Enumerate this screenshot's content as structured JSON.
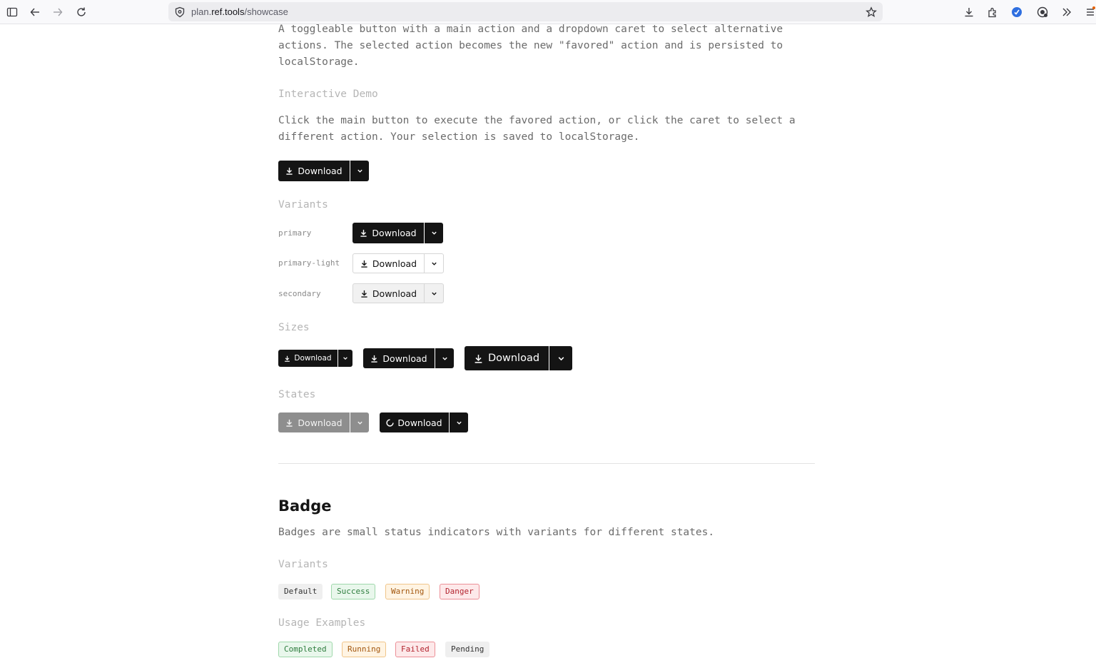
{
  "browser": {
    "url_prefix": "plan.",
    "url_domain": "ref.tools",
    "url_path": "/showcase"
  },
  "intro": {
    "description": "A toggleable button with a main action and a dropdown caret to select alternative actions. The selected action becomes the new \"favored\" action and is persisted to localStorage."
  },
  "demo": {
    "heading": "Interactive Demo",
    "description": "Click the main button to execute the favored action, or click the caret to select a different action. Your selection is saved to localStorage.",
    "button_label": "Download"
  },
  "variants": {
    "heading": "Variants",
    "items": [
      {
        "name": "primary",
        "label": "Download"
      },
      {
        "name": "primary-light",
        "label": "Download"
      },
      {
        "name": "secondary",
        "label": "Download"
      }
    ]
  },
  "sizes": {
    "heading": "Sizes",
    "labels": [
      "Download",
      "Download",
      "Download"
    ]
  },
  "states": {
    "heading": "States",
    "disabled_label": "Download",
    "loading_label": "Download"
  },
  "badge": {
    "title": "Badge",
    "description": "Badges are small status indicators with variants for different states.",
    "variants_heading": "Variants",
    "variants": [
      "Default",
      "Success",
      "Warning",
      "Danger"
    ],
    "usage_heading": "Usage Examples",
    "usage": [
      "Completed",
      "Running",
      "Failed",
      "Pending"
    ]
  },
  "colors": {
    "primary": "#141414",
    "success": "#2e7d3e",
    "warning": "#a3570e",
    "danger": "#b3242f"
  }
}
